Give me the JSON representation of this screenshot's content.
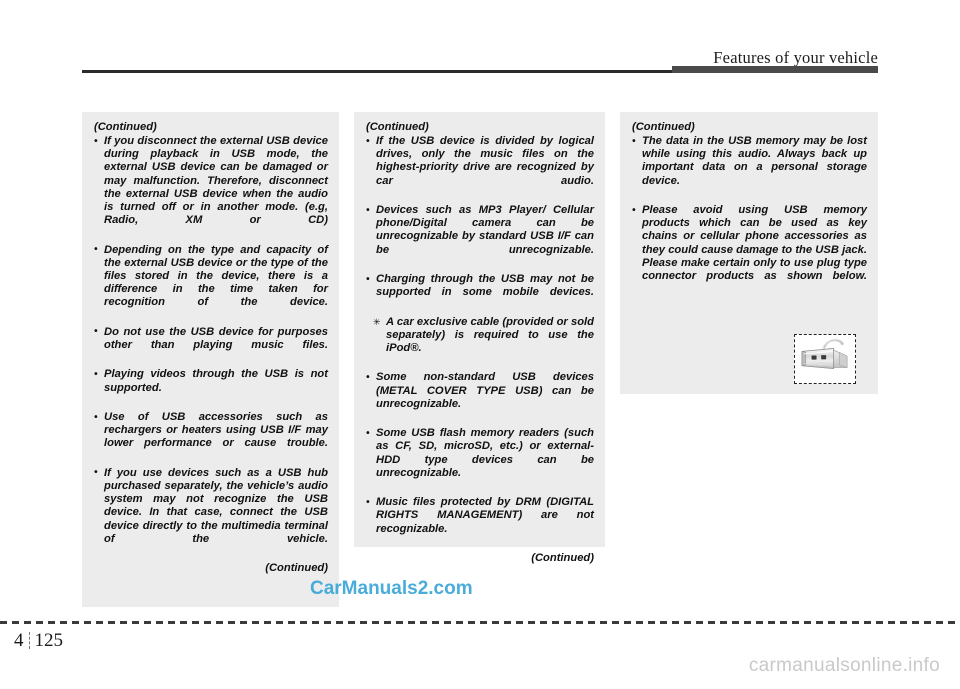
{
  "header": {
    "title": "Features of your vehicle"
  },
  "columns": [
    {
      "continued_label": "(Continued)",
      "items": [
        {
          "marker": "dot",
          "text": "If you disconnect the external USB device during playback in USB mode, the external USB device can be damaged or may malfunction. Therefore, disconnect the external USB device when the audio is turned off or in another mode. (e.g, Radio, XM or CD)"
        },
        {
          "marker": "dot",
          "text": "Depending on the type and capacity of the external USB device or the type of the files stored in the device, there is a difference in the time taken for recognition of the device."
        },
        {
          "marker": "dot",
          "text": "Do not use the USB device for purposes other than playing music files."
        },
        {
          "marker": "dot",
          "text": "Playing videos through the USB is not supported."
        },
        {
          "marker": "dot",
          "text": "Use of USB accessories such as rechargers or heaters using USB I/F may lower performance or cause trouble."
        },
        {
          "marker": "dot",
          "text": "If you use devices such as a USB hub purchased separately, the vehicle’s audio system may not recognize the USB device. In that case, connect the USB device directly to the multimedia terminal of the vehicle."
        }
      ],
      "end_label": "(Continued)"
    },
    {
      "continued_label": "(Continued)",
      "items": [
        {
          "marker": "dot",
          "text": "If the USB device is divided by logical drives, only the music files on the highest-priority drive are recognized by car audio."
        },
        {
          "marker": "dot",
          "text": "Devices such as MP3 Player/ Cellular phone/Digital camera can be unrecognizable by standard USB I/F can be unrecognizable."
        },
        {
          "marker": "dot",
          "text": "Charging through the USB may not be supported in some mobile devices."
        },
        {
          "marker": "star",
          "text": "A car exclusive cable (provided or sold separately) is required to use the iPod®."
        },
        {
          "marker": "dot",
          "text": "Some non-standard USB devices (METAL COVER TYPE USB) can be unrecognizable."
        },
        {
          "marker": "dot",
          "text": "Some USB flash memory readers (such as CF, SD, microSD, etc.) or external-HDD type devices can be unrecognizable."
        },
        {
          "marker": "dot",
          "text": "Music files protected by DRM (DIGITAL RIGHTS MANAGEMENT) are not recognizable."
        }
      ],
      "end_label": "(Continued)"
    },
    {
      "continued_label": "(Continued)",
      "items": [
        {
          "marker": "dot",
          "text": "The data in the USB memory may be lost while using this audio. Always back up important data on a personal storage device."
        },
        {
          "marker": "dot",
          "text": "Please avoid using USB memory products which can be used as key chains or cellular phone accessories as they could cause damage to the USB jack. Please make certain only to use plug type connector products as shown below."
        }
      ],
      "end_label": "",
      "figure": {
        "name": "usb-flash-drive-photo",
        "alt": "USB plug type connector"
      }
    }
  ],
  "footer": {
    "chapter": "4",
    "page": "125"
  },
  "watermarks": {
    "middle": "CarManuals2.com",
    "bottom": "carmanualsonline.info"
  },
  "colors": {
    "panel_bg": "#ececec",
    "rule": "#2b2b2b",
    "watermark_blue": "#3aa6d8",
    "watermark_gray": "#c9c9c9"
  }
}
